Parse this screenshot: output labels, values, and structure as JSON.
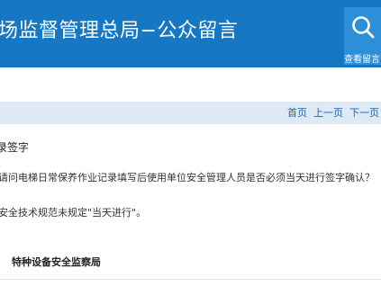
{
  "header": {
    "title": "场监督管理总局−公众留言",
    "search_label": "查看留言",
    "bg_color": "#1677c4",
    "search_bg_color": "#2d8fd8"
  },
  "nav": {
    "links": [
      "首页",
      "上一页",
      "下一页"
    ],
    "link_color": "#1d63b0",
    "bg_color": "#dde9f5"
  },
  "message": {
    "title": "录签字",
    "question": "请问电梯日常保养作业记录填写后使用单位安全管理人员是否必须当天进行签字确认？",
    "answer": "安全技术规范未规定\"当天进行\"。",
    "department": "特种设备安全监察局"
  }
}
